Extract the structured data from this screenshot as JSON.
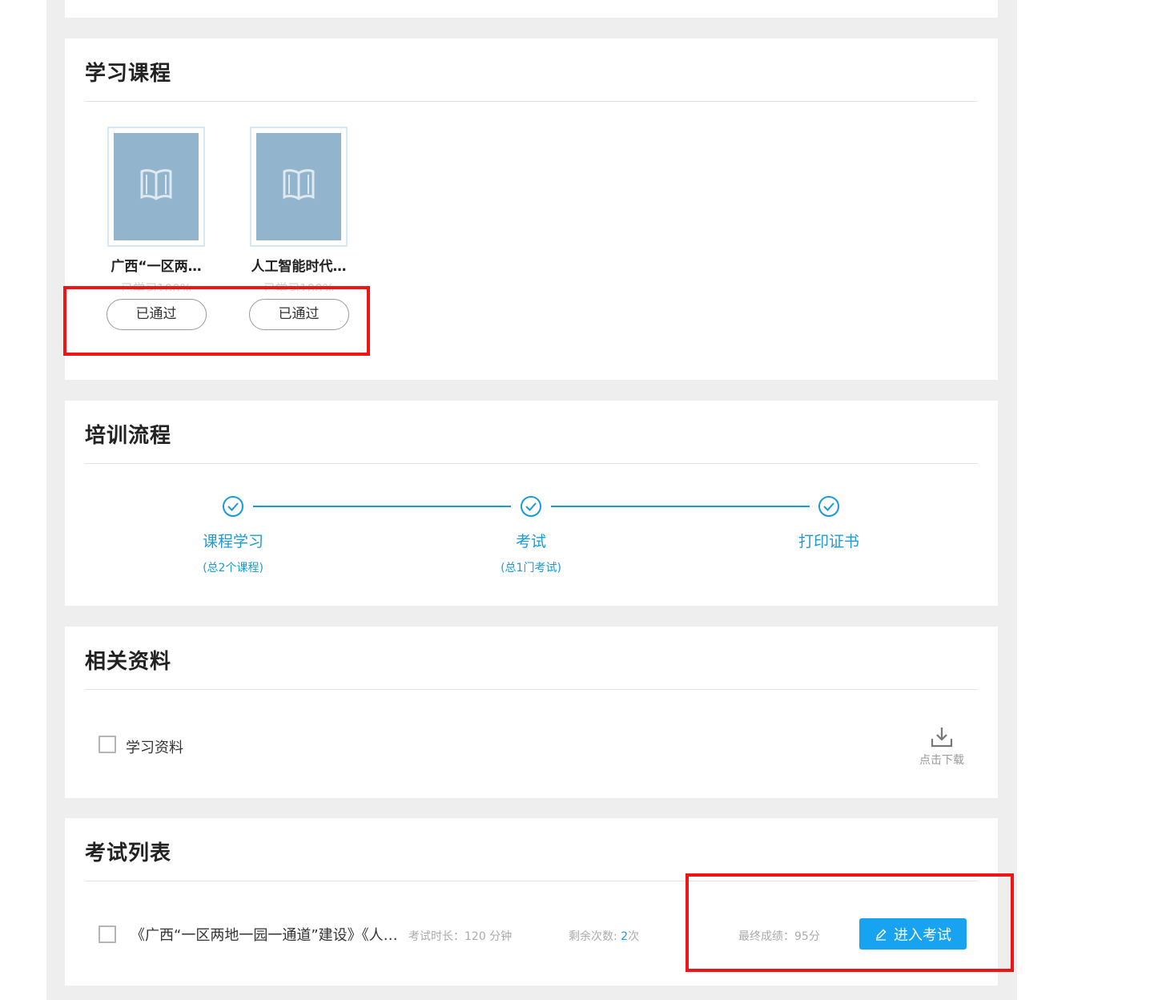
{
  "courses": {
    "title": "学习课程",
    "items": [
      {
        "title": "广西“一区两…",
        "progress": "已学习100%",
        "status": "已通过"
      },
      {
        "title": "人工智能时代…",
        "progress": "已学习100%",
        "status": "已通过"
      }
    ]
  },
  "flow": {
    "title": "培训流程",
    "steps": [
      {
        "label": "课程学习",
        "sub": "(总2个课程)"
      },
      {
        "label": "考试",
        "sub": "(总1门考试)"
      },
      {
        "label": "打印证书",
        "sub": ""
      }
    ]
  },
  "materials": {
    "title": "相关资料",
    "item_label": "学习资料",
    "download_label": "点击下载"
  },
  "exams": {
    "title": "考试列表",
    "item": {
      "title": "《广西“一区两地一园一通道”建设》《人工智能时代…",
      "duration_label": "考试时长：",
      "duration_value": "120 分钟",
      "remaining_label": "剩余次数: ",
      "remaining_value": "2",
      "remaining_unit": "次",
      "score_label": "最终成绩：",
      "score_value": "95分",
      "enter_label": "进入考试"
    }
  },
  "colors": {
    "accent": "#1a9ad6",
    "button": "#17a3f0",
    "highlight": "#f01414",
    "thumb": "#92b4cc"
  }
}
